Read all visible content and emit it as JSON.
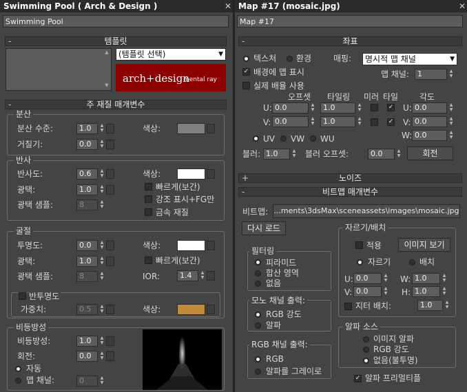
{
  "left": {
    "title": "Swimming Pool  ( Arch & Design )",
    "name_value": "Swimming Pool",
    "templates": {
      "header": "템플릿",
      "dropdown": "(템플릿 선택)",
      "brand_main": "arch+design",
      "brand_sub": "mental ray"
    },
    "main_params": {
      "header": "주 재질 매개변수"
    },
    "diffuse": {
      "title": "분산",
      "level_label": "분산 수준:",
      "level": "1.0",
      "roughness_label": "거칠기:",
      "roughness": "0.0",
      "color_label": "색상:",
      "color": "#808080"
    },
    "reflection": {
      "title": "반사",
      "refl_label": "반사도:",
      "refl": "0.6",
      "gloss_label": "광택:",
      "gloss": "1.0",
      "samples_label": "광택 샘플:",
      "samples": "8",
      "color_label": "색상:",
      "color": "#ffffff",
      "fast_label": "빠르게(보간)",
      "highlights_label": "강조 표시+FG만",
      "metal_label": "금속 재질"
    },
    "refraction": {
      "title": "굴절",
      "transp_label": "투명도:",
      "transp": "0.0",
      "gloss_label": "광택:",
      "gloss": "1.0",
      "samples_label": "광택 샘플:",
      "samples": "8",
      "color_label": "색상:",
      "color": "#ffffff",
      "fast_label": "빠르게(보간)",
      "ior_label": "IOR:",
      "ior": "1.4"
    },
    "translucency": {
      "label": "반투명도",
      "weight_label": "가중치:",
      "weight": "0.5",
      "color_label": "색상:",
      "color": "#c08a3a"
    },
    "anisotropy": {
      "title": "비등방성",
      "aniso_label": "비등방성:",
      "aniso": "1.0",
      "rotation_label": "회전:",
      "rotation": "0.0",
      "auto_label": "자동",
      "mapch_label": "맵 채널:",
      "mapch": "0"
    }
  },
  "right": {
    "title": "Map #17 (mosaic.jpg)",
    "name_value": "Map #17",
    "coords": {
      "header": "좌표",
      "texture_label": "텍스처",
      "env_label": "환경",
      "mapping_label": "매핑:",
      "mapping_value": "명시적 맵 채널",
      "show_map_back_label": "배경에 맵 표시",
      "map_channel_label": "맵 채널:",
      "map_channel": "1",
      "real_world_label": "실제 배율 사용",
      "offset_label": "오프셋",
      "tiling_label": "타일링",
      "mirror_label": "미러",
      "tile_label": "타일",
      "angle_label": "각도",
      "u_label": "U:",
      "v_label": "V:",
      "w_label": "W:",
      "u_offset": "0.0",
      "v_offset": "0.0",
      "u_tiling": "1.0",
      "v_tiling": "1.0",
      "u_angle": "0.0",
      "v_angle": "0.0",
      "w_angle": "0.0",
      "uv_label": "UV",
      "vw_label": "VW",
      "wu_label": "WU",
      "blur_label": "블러:",
      "blur": "1.0",
      "blur_offset_label": "블러 오프셋:",
      "blur_offset": "0.0",
      "rotate_label": "회전"
    },
    "noise": {
      "header": "노이즈"
    },
    "bitmap": {
      "header": "비트맵 매개변수",
      "bitmap_label": "비트맵:",
      "path": "...ments\\3dsMax\\sceneassets\\images\\mosaic.jpg",
      "reload_label": "다시 로드",
      "filtering": {
        "title": "필터링",
        "pyramid": "피라미드",
        "summed": "합산 영역",
        "none": "없음"
      },
      "mono": {
        "title": "모노 채널 출력:",
        "rgb_intensity": "RGB 강도",
        "alpha": "알파"
      },
      "rgb": {
        "title": "RGB 채널 출력:",
        "rgb": "RGB",
        "alpha_as_gray": "알파를 그레이로"
      },
      "crop": {
        "title": "자르기/배치",
        "apply_label": "적용",
        "view_image_label": "이미지 보기",
        "crop_label": "자르기",
        "place_label": "배치",
        "u_label": "U:",
        "v_label": "V:",
        "w_label": "W:",
        "h_label": "H:",
        "u": "0.0",
        "v": "0.0",
        "w": "1.0",
        "h": "1.0",
        "jitter_label": "지터 배치:",
        "jitter": "1.0"
      },
      "alpha_source": {
        "title": "알파 소스",
        "image_alpha": "이미지 알파",
        "rgb_intensity": "RGB 강도",
        "none_opaque": "없음(불투명)"
      },
      "premult_label": "알파 프리멀티플"
    }
  }
}
